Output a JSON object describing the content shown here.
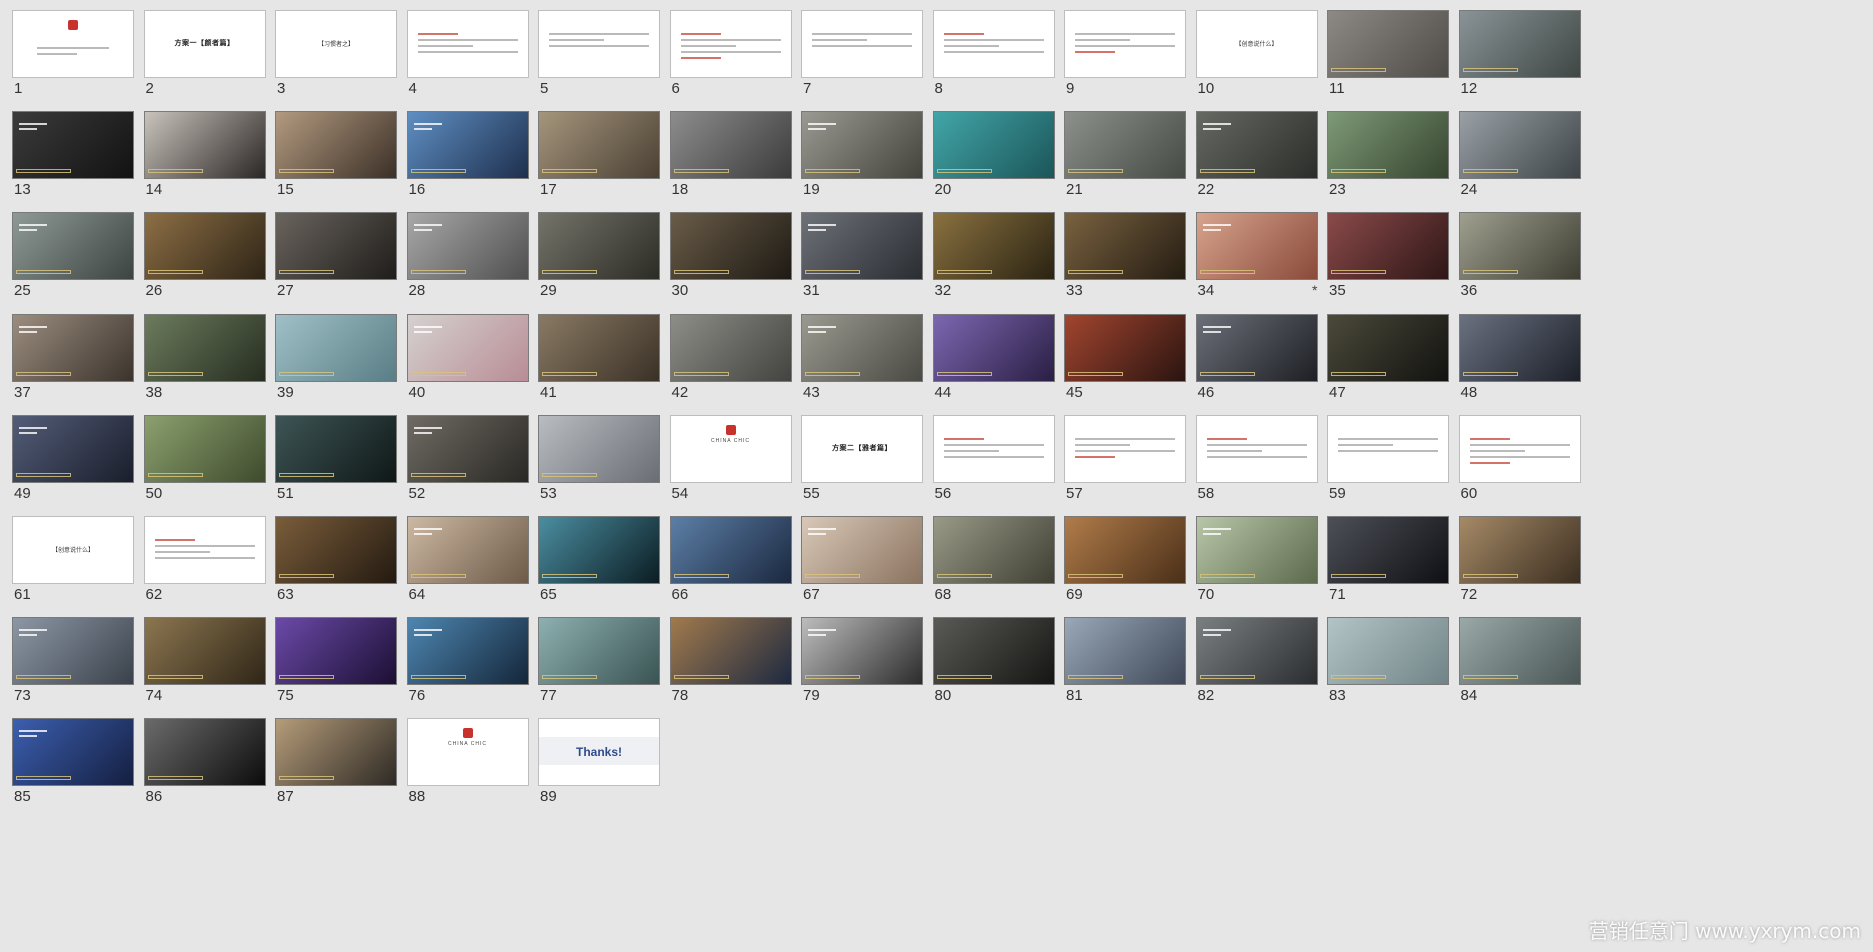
{
  "watermark": "营销任意门 www.yxrym.com",
  "slides": [
    {
      "n": "1",
      "kind": "cover"
    },
    {
      "n": "2",
      "kind": "title",
      "text": "方案一【颜者篇】"
    },
    {
      "n": "3",
      "kind": "bracket",
      "text": "【习惯者之】"
    },
    {
      "n": "4",
      "kind": "text"
    },
    {
      "n": "5",
      "kind": "text"
    },
    {
      "n": "6",
      "kind": "text"
    },
    {
      "n": "7",
      "kind": "text"
    },
    {
      "n": "8",
      "kind": "text"
    },
    {
      "n": "9",
      "kind": "text"
    },
    {
      "n": "10",
      "kind": "bracket",
      "text": "【创意说什么】"
    },
    {
      "n": "11",
      "kind": "photo",
      "c": "#8d8a86",
      "c2": "#4f4b46"
    },
    {
      "n": "12",
      "kind": "photo",
      "c": "#8a9497",
      "c2": "#3e4744"
    },
    {
      "n": "13",
      "kind": "photo",
      "c": "#3b3b3b",
      "c2": "#121212"
    },
    {
      "n": "14",
      "kind": "photo",
      "c": "#c9c3bc",
      "c2": "#2b2725"
    },
    {
      "n": "15",
      "kind": "photo",
      "c": "#b39a80",
      "c2": "#3b3027"
    },
    {
      "n": "16",
      "kind": "photo",
      "c": "#5f8fc3",
      "c2": "#1e2f4d"
    },
    {
      "n": "17",
      "kind": "photo",
      "c": "#a5957c",
      "c2": "#4a4033"
    },
    {
      "n": "18",
      "kind": "photo",
      "c": "#8d8d8d",
      "c2": "#3b3b3b"
    },
    {
      "n": "19",
      "kind": "photo",
      "c": "#9a9a92",
      "c2": "#43433c"
    },
    {
      "n": "20",
      "kind": "photo",
      "c": "#42a6a8",
      "c2": "#1b5559"
    },
    {
      "n": "21",
      "kind": "photo",
      "c": "#8c918c",
      "c2": "#464a44"
    },
    {
      "n": "22",
      "kind": "photo",
      "c": "#666962",
      "c2": "#2b2d2a"
    },
    {
      "n": "23",
      "kind": "photo",
      "c": "#7e9a77",
      "c2": "#36452f"
    },
    {
      "n": "24",
      "kind": "photo",
      "c": "#9aa1a6",
      "c2": "#3d4346"
    },
    {
      "n": "25",
      "kind": "photo",
      "c": "#8f9a96",
      "c2": "#3c4441"
    },
    {
      "n": "26",
      "kind": "photo",
      "c": "#8d6f45",
      "c2": "#2e2416"
    },
    {
      "n": "27",
      "kind": "photo",
      "c": "#6a645e",
      "c2": "#1f1d1a"
    },
    {
      "n": "28",
      "kind": "photo",
      "c": "#a8a8a8",
      "c2": "#4f4f4f"
    },
    {
      "n": "29",
      "kind": "photo",
      "c": "#74746a",
      "c2": "#2c2c26"
    },
    {
      "n": "30",
      "kind": "photo",
      "c": "#6a5c48",
      "c2": "#1e1a14"
    },
    {
      "n": "31",
      "kind": "photo",
      "c": "#6d7178",
      "c2": "#2a2d32"
    },
    {
      "n": "32",
      "kind": "photo",
      "c": "#8a7140",
      "c2": "#2a2312"
    },
    {
      "n": "33",
      "kind": "photo",
      "c": "#7a6240",
      "c2": "#241c12"
    },
    {
      "n": "34",
      "kind": "photo",
      "c": "#d7a48d",
      "c2": "#8a4a3a",
      "star": "*"
    },
    {
      "n": "35",
      "kind": "photo",
      "c": "#8b4a4a",
      "c2": "#2e1616"
    },
    {
      "n": "36",
      "kind": "photo",
      "c": "#a0a090",
      "c2": "#3d3d32"
    },
    {
      "n": "37",
      "kind": "photo",
      "c": "#9c8d7f",
      "c2": "#3b332c"
    },
    {
      "n": "38",
      "kind": "photo",
      "c": "#6c7c5d",
      "c2": "#262d20"
    },
    {
      "n": "39",
      "kind": "photo",
      "c": "#9fc0c6",
      "c2": "#5a7e86"
    },
    {
      "n": "40",
      "kind": "photo",
      "c": "#d5d1cf",
      "c2": "#b88d95"
    },
    {
      "n": "41",
      "kind": "photo",
      "c": "#8a7a64",
      "c2": "#3a3126"
    },
    {
      "n": "42",
      "kind": "photo",
      "c": "#8e8e88",
      "c2": "#43433f"
    },
    {
      "n": "43",
      "kind": "photo",
      "c": "#9a9a90",
      "c2": "#4a4a44"
    },
    {
      "n": "44",
      "kind": "photo",
      "c": "#7c67b1",
      "c2": "#2a1e44"
    },
    {
      "n": "45",
      "kind": "photo",
      "c": "#a2452f",
      "c2": "#2a1410"
    },
    {
      "n": "46",
      "kind": "photo",
      "c": "#6b6f78",
      "c2": "#1d1f24"
    },
    {
      "n": "47",
      "kind": "photo",
      "c": "#4b4a3a",
      "c2": "#121210"
    },
    {
      "n": "48",
      "kind": "photo",
      "c": "#6a7180",
      "c2": "#1c2029"
    },
    {
      "n": "49",
      "kind": "photo",
      "c": "#535d78",
      "c2": "#1a1e2b"
    },
    {
      "n": "50",
      "kind": "photo",
      "c": "#8ca06f",
      "c2": "#3e4b2c"
    },
    {
      "n": "51",
      "kind": "photo",
      "c": "#3e5555",
      "c2": "#0f1717"
    },
    {
      "n": "52",
      "kind": "photo",
      "c": "#6f6b64",
      "c2": "#2a2824"
    },
    {
      "n": "53",
      "kind": "photo",
      "c": "#b9bcc1",
      "c2": "#6a6e74"
    },
    {
      "n": "54",
      "kind": "logo",
      "text": "CHINA CHIC"
    },
    {
      "n": "55",
      "kind": "title",
      "text": "方案二【雅者篇】"
    },
    {
      "n": "56",
      "kind": "text"
    },
    {
      "n": "57",
      "kind": "text"
    },
    {
      "n": "58",
      "kind": "text"
    },
    {
      "n": "59",
      "kind": "text"
    },
    {
      "n": "60",
      "kind": "text"
    },
    {
      "n": "61",
      "kind": "bracket",
      "text": "【创意说什么】"
    },
    {
      "n": "62",
      "kind": "text"
    },
    {
      "n": "63",
      "kind": "photo",
      "c": "#7a5d3b",
      "c2": "#231a10"
    },
    {
      "n": "64",
      "kind": "photo",
      "c": "#cdb9a3",
      "c2": "#6d5a47"
    },
    {
      "n": "65",
      "kind": "photo",
      "c": "#4b8ea1",
      "c2": "#0b1c22"
    },
    {
      "n": "66",
      "kind": "photo",
      "c": "#5c7fa6",
      "c2": "#1b2840"
    },
    {
      "n": "67",
      "kind": "photo",
      "c": "#d9c8b8",
      "c2": "#8a735f"
    },
    {
      "n": "68",
      "kind": "photo",
      "c": "#9a9a88",
      "c2": "#3f3f33"
    },
    {
      "n": "69",
      "kind": "photo",
      "c": "#b17c4a",
      "c2": "#4a2f18"
    },
    {
      "n": "70",
      "kind": "photo",
      "c": "#b9c6a9",
      "c2": "#5c6a4c"
    },
    {
      "n": "71",
      "kind": "photo",
      "c": "#4d5058",
      "c2": "#0f1014"
    },
    {
      "n": "72",
      "kind": "photo",
      "c": "#a68a67",
      "c2": "#3b2e20"
    },
    {
      "n": "73",
      "kind": "photo",
      "c": "#8d98a5",
      "c2": "#3a414b"
    },
    {
      "n": "74",
      "kind": "photo",
      "c": "#8c7650",
      "c2": "#2f2617"
    },
    {
      "n": "75",
      "kind": "photo",
      "c": "#6b4aa8",
      "c2": "#1b0f33"
    },
    {
      "n": "76",
      "kind": "photo",
      "c": "#4e86b0",
      "c2": "#14263a"
    },
    {
      "n": "77",
      "kind": "photo",
      "c": "#8eb0b0",
      "c2": "#3a5353"
    },
    {
      "n": "78",
      "kind": "photo",
      "c": "#a17a4d",
      "c2": "#1d2940"
    },
    {
      "n": "79",
      "kind": "photo",
      "c": "#bdbdbd",
      "c2": "#2c2c2c"
    },
    {
      "n": "80",
      "kind": "photo",
      "c": "#5a5a56",
      "c2": "#151513"
    },
    {
      "n": "81",
      "kind": "photo",
      "c": "#9aa8b8",
      "c2": "#3e4858"
    },
    {
      "n": "82",
      "kind": "photo",
      "c": "#7a7f82",
      "c2": "#2a2d30"
    },
    {
      "n": "83",
      "kind": "photo",
      "c": "#b4c4c6",
      "c2": "#708487"
    },
    {
      "n": "84",
      "kind": "photo",
      "c": "#9aa8a8",
      "c2": "#4a5656"
    },
    {
      "n": "85",
      "kind": "photo",
      "c": "#3c5fb0",
      "c2": "#141f40"
    },
    {
      "n": "86",
      "kind": "photo",
      "c": "#6b6b6b",
      "c2": "#0c0c0c"
    },
    {
      "n": "87",
      "kind": "photo",
      "c": "#b59c7a",
      "c2": "#2e2a24"
    },
    {
      "n": "88",
      "kind": "logo",
      "text": "CHINA CHIC"
    },
    {
      "n": "89",
      "kind": "thanks",
      "text": "Thanks!"
    }
  ]
}
